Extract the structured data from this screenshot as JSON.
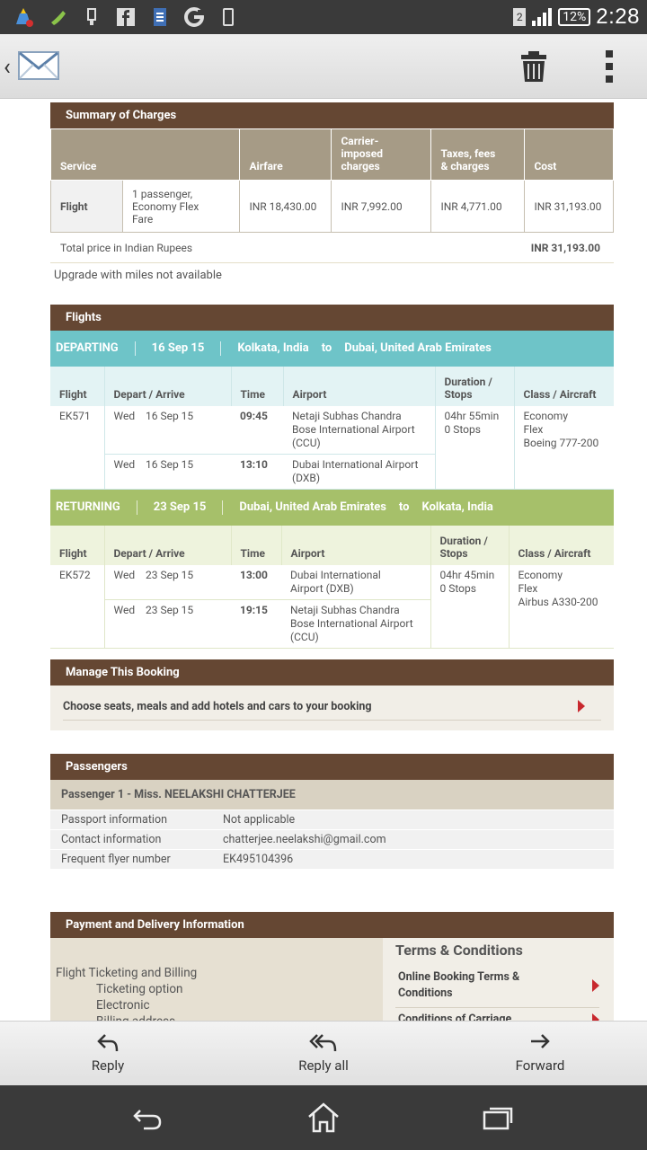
{
  "status_bar": {
    "time": "2:28",
    "battery": "12%",
    "sim": "2"
  },
  "summary": {
    "header": "Summary of Charges",
    "columns": {
      "service": "Service",
      "airfare": "Airfare",
      "carrier": "Carrier-\nimposed\ncharges",
      "taxes": "Taxes, fees\n& charges",
      "cost": "Cost"
    },
    "row": {
      "service": "Flight",
      "description": "1 passenger,\nEconomy Flex\nFare",
      "airfare": "INR 18,430.00",
      "carrier": "INR 7,992.00",
      "taxes": "INR 4,771.00",
      "cost": "INR 31,193.00"
    },
    "total_label": "Total price in  Indian Rupees",
    "total_value": "INR 31,193.00",
    "upgrade_note": "Upgrade with miles not available"
  },
  "flights": {
    "header": "Flights",
    "columns": {
      "flight": "Flight",
      "depart_arrive": "Depart / Arrive",
      "time": "Time",
      "airport": "Airport",
      "duration": "Duration /\nStops",
      "class": "Class / Aircraft"
    },
    "departing": {
      "label": "DEPARTING",
      "date": "16 Sep 15",
      "from": "Kolkata, India",
      "to_word": "to",
      "to": "Dubai, United Arab Emirates",
      "flight_no": "EK571",
      "dep_day": "Wed",
      "dep_date": "16 Sep 15",
      "dep_time": "09:45",
      "dep_airport": "Netaji Subhas Chandra\nBose International Airport\n(CCU)",
      "arr_day": "Wed",
      "arr_date": "16 Sep 15",
      "arr_time": "13:10",
      "arr_airport": "Dubai International Airport\n(DXB)",
      "duration": "04hr 55min\n0 Stops",
      "class": "Economy\nFlex\nBoeing 777-200"
    },
    "returning": {
      "label": "RETURNING",
      "date": "23 Sep 15",
      "from": "Dubai, United Arab Emirates",
      "to_word": "to",
      "to": "Kolkata, India",
      "flight_no": "EK572",
      "dep_day": "Wed",
      "dep_date": "23 Sep 15",
      "dep_time": "13:00",
      "dep_airport": "Dubai International\nAirport (DXB)",
      "arr_day": "Wed",
      "arr_date": "23 Sep 15",
      "arr_time": "19:15",
      "arr_airport": "Netaji Subhas Chandra\nBose International Airport\n(CCU)",
      "duration": "04hr 45min\n0 Stops",
      "class": "Economy\nFlex\nAirbus A330-200"
    }
  },
  "manage": {
    "header": "Manage This Booking",
    "link": "Choose seats, meals and add hotels and cars to your booking"
  },
  "passengers": {
    "header": "Passengers",
    "title": "Passenger  1 -  Miss. NEELAKSHI CHATTERJEE",
    "rows": [
      {
        "label": "Passport information",
        "value": "Not applicable"
      },
      {
        "label": "Contact information",
        "value": "chatterjee.neelakshi@gmail.com"
      },
      {
        "label": "Frequent flyer number",
        "value": "EK495104396"
      }
    ]
  },
  "payment": {
    "header": "Payment and Delivery Information",
    "left_title": "Flight Ticketing and Billing",
    "left_items": [
      "Ticketing option",
      "Electronic",
      "Billing address"
    ],
    "terms_title": "Terms & Conditions",
    "terms_links": [
      "Online Booking Terms &\nConditions",
      "Conditions of Carriage"
    ]
  },
  "actions": {
    "reply": "Reply",
    "reply_all": "Reply all",
    "forward": "Forward"
  },
  "colors": {
    "section_header": "#654733",
    "departing_bar": "#6ec4c8",
    "returning_bar": "#a6c06a",
    "link_arrow": "#c8282e"
  }
}
